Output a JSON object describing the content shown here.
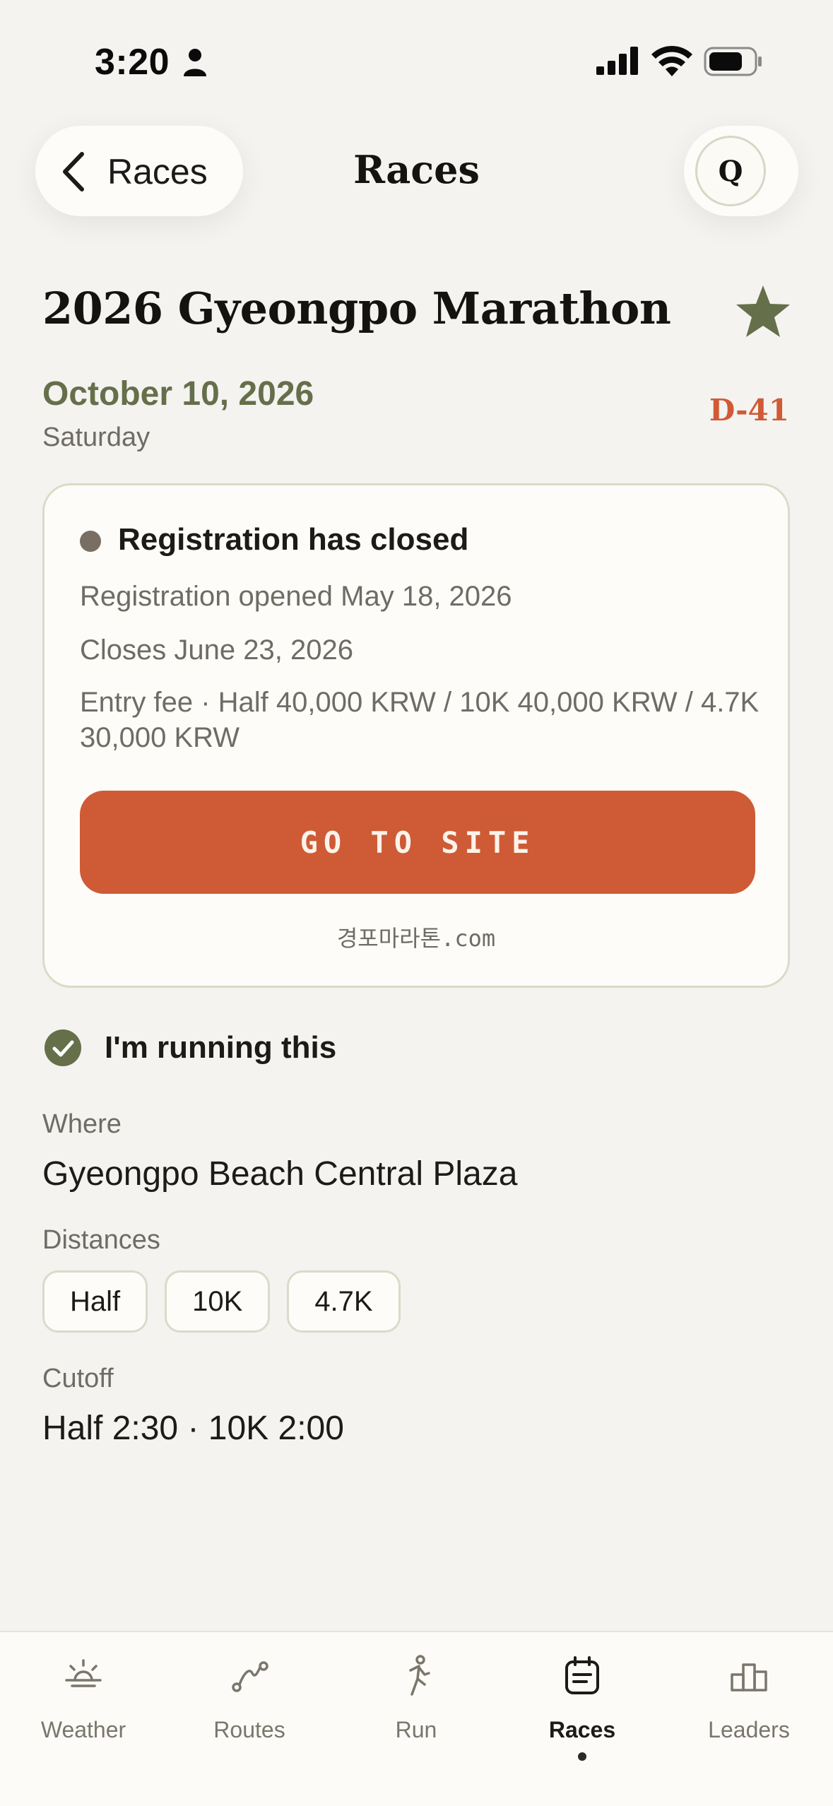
{
  "status_bar": {
    "time": "3:20",
    "icons": [
      "person-icon",
      "cellular-signal-icon",
      "wifi-icon",
      "battery-icon"
    ]
  },
  "nav": {
    "back_label": "Races",
    "title": "Races",
    "profile_initial": "Q"
  },
  "race": {
    "title": "2026 Gyeongpo Marathon",
    "date": "October 10, 2026",
    "day": "Saturday",
    "countdown": "D-41",
    "favorite_icon": "star-icon"
  },
  "registration": {
    "status": "Registration has closed",
    "opened": "Registration opened May 18, 2026",
    "closes": "Closes June 23, 2026",
    "entry_fee": "Entry fee · Half 40,000 KRW / 10K 40,000 KRW / 4.7K 30,000 KRW",
    "button_label": "GO TO SITE",
    "site_url": "경포마라톤.com"
  },
  "participation": {
    "label": "I'm running this",
    "checked": true
  },
  "details": {
    "where_label": "Where",
    "where_value": "Gyeongpo Beach Central Plaza",
    "distances_label": "Distances",
    "distances": [
      "Half",
      "10K",
      "4.7K"
    ],
    "cutoff_label": "Cutoff",
    "cutoff_value": "Half 2:30 · 10K 2:00"
  },
  "tabs": [
    {
      "label": "Weather",
      "icon": "sun-horizon-icon",
      "active": false
    },
    {
      "label": "Routes",
      "icon": "route-icon",
      "active": false
    },
    {
      "label": "Run",
      "icon": "runner-icon",
      "active": false
    },
    {
      "label": "Races",
      "icon": "calendar-icon",
      "active": true
    },
    {
      "label": "Leaders",
      "icon": "podium-icon",
      "active": false
    }
  ],
  "colors": {
    "accent": "#ce5b36",
    "olive": "#656f4a",
    "background": "#f4f3f0",
    "card": "#fdfcf8"
  }
}
